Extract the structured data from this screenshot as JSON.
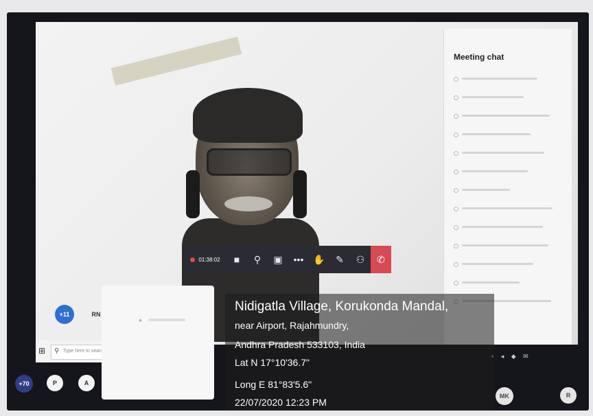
{
  "chat": {
    "title": "Meeting chat",
    "messages": [
      "",
      "",
      "",
      "",
      "",
      "",
      "",
      "",
      "",
      "",
      "",
      "",
      ""
    ]
  },
  "controls": {
    "timer": "01:38:02",
    "items": [
      "camera-icon",
      "microphone-icon",
      "share-screen-icon",
      "more-icon",
      "raise-hand-icon",
      "chat-icon",
      "participants-icon",
      "hang-up-icon"
    ]
  },
  "participants": {
    "overflow_badge": "+11",
    "rn": "RN",
    "count_badge": "+70",
    "p": "P",
    "a": "A",
    "mk": "MK",
    "r": "R"
  },
  "taskbar": {
    "search_placeholder": "Type here to search"
  },
  "geotag": {
    "line1": "Nidigatla Village, Korukonda Mandal,",
    "line2": "near Airport, Rajahmundry,",
    "line3": "Andhra Pradesh 533103, India",
    "lat": "Lat N 17°10'36.7\"",
    "long": "Long E 81°83'5.6\"",
    "datetime": "22/07/2020   12:23 PM"
  },
  "colors": {
    "hangup": "#d64a53",
    "accent": "#2e6fd1",
    "record": "#e14949"
  }
}
